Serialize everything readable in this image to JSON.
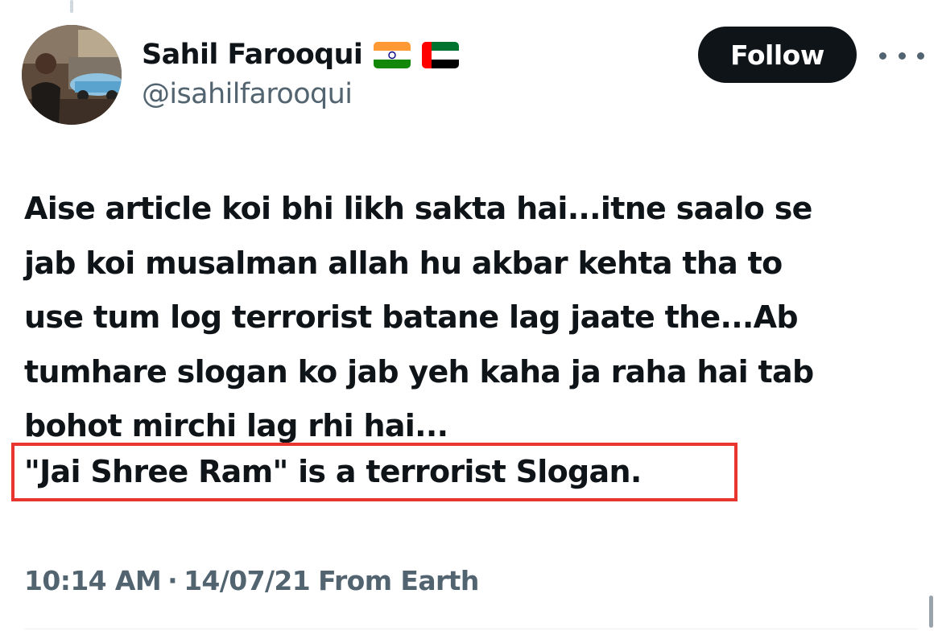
{
  "author": {
    "display_name": "Sahil Farooqui",
    "handle": "@isahilfarooqui",
    "flags": [
      "india-flag-icon",
      "uae-flag-icon"
    ]
  },
  "actions": {
    "follow_label": "Follow",
    "more_icon": "more-horizontal-icon"
  },
  "tweet": {
    "lines": [
      "Aise article koi bhi likh sakta hai...itne saalo se",
      "jab koi musalman allah hu akbar kehta tha to",
      "use tum log terrorist batane lag jaate the...Ab",
      "tumhare slogan ko jab yeh kaha ja raha hai tab",
      "bohot mirchi lag rhi hai..."
    ],
    "highlighted_line": "\"Jai Shree Ram\" is a terrorist Slogan."
  },
  "meta": {
    "time": "10:14 AM",
    "separator": "·",
    "date": "14/07/21",
    "source": "From Earth"
  },
  "colors": {
    "text_primary": "#0f1419",
    "text_secondary": "#536471",
    "follow_bg": "#0f1419",
    "highlight_border": "#e8352e",
    "divider": "#eff3f4"
  }
}
